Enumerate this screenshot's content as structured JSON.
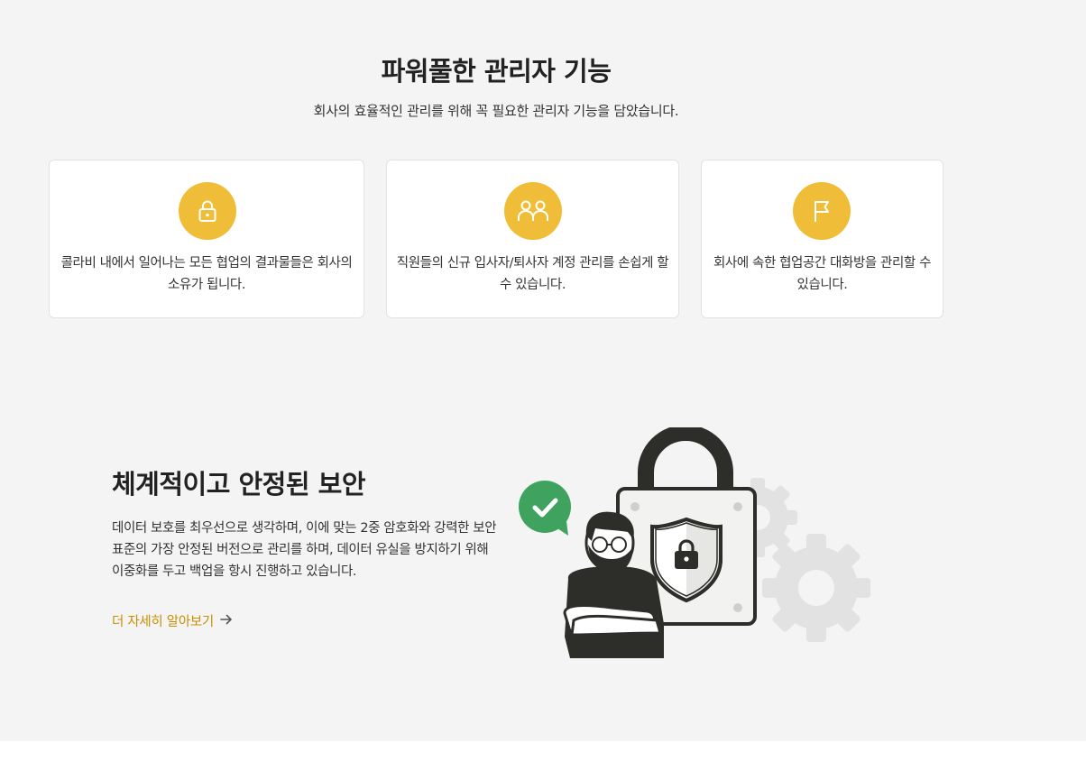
{
  "admin": {
    "title": "파워풀한 관리자 기능",
    "subtitle": "회사의 효율적인 관리를 위해 꼭 필요한 관리자 기능을 담았습니다."
  },
  "cards": [
    {
      "icon": "lock-icon",
      "text": "콜라비 내에서 일어나는 모든 협업의 결과물들은 회사의 소유가 됩니다."
    },
    {
      "icon": "users-icon",
      "text": "직원들의 신규 입사자/퇴사자 계정 관리를 손쉽게 할 수 있습니다."
    },
    {
      "icon": "flag-icon",
      "text": "회사에 속한 협업공간 대화방을 관리할 수 있습니다."
    }
  ],
  "security": {
    "title": "체계적이고 안정된 보안",
    "description": "데이터 보호를 최우선으로 생각하며, 이에 맞는 2중 암호화와 강력한 보안 표준의 가장 안정된 버전으로 관리를 하며, 데이터 유실을 방지하기 위해 이중화를 두고 백업을 항시 진행하고 있습니다.",
    "link_label": "더 자세히 알아보기",
    "link_icon": "arrow-right-icon",
    "illustration_icons": [
      "check-bubble-icon",
      "padlock-icon",
      "shield-icon",
      "gear-icon",
      "person-icon"
    ]
  },
  "colors": {
    "accent": "#f0bd38",
    "link": "#c98f00",
    "background": "#f4f4f4",
    "check": "#3fa35f"
  }
}
